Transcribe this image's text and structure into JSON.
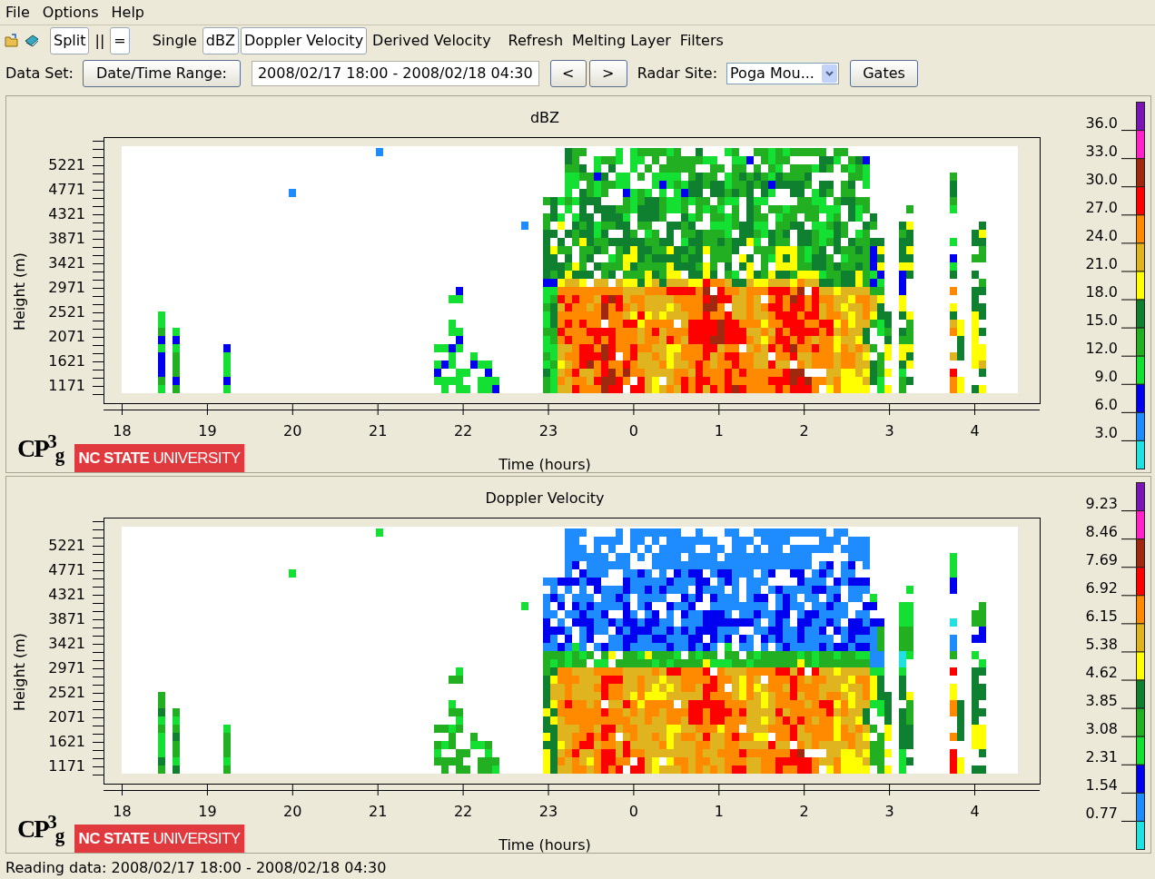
{
  "menu": [
    {
      "label": "File"
    },
    {
      "label": "Options"
    },
    {
      "label": "Help"
    }
  ],
  "toolbar": {
    "items": [
      {
        "label": "Split",
        "selected": true
      },
      {
        "label": "||",
        "selected": false
      },
      {
        "label": "=",
        "selected": true
      },
      {
        "label": "Single",
        "selected": false
      },
      {
        "label": "dBZ",
        "selected": true
      },
      {
        "label": "Doppler Velocity",
        "selected": true
      },
      {
        "label": "Derived Velocity",
        "selected": false
      },
      {
        "label": "Refresh",
        "selected": false
      },
      {
        "label": "Melting Layer",
        "selected": false
      },
      {
        "label": "Filters",
        "selected": false
      }
    ]
  },
  "dataset": {
    "label": "Data Set:",
    "range_button": "Date/Time Range:",
    "range_value": "2008/02/17 18:00 - 2008/02/18 04:30",
    "prev_button": "<",
    "next_button": ">",
    "site_label": "Radar Site:",
    "site_value": "Poga Mou...",
    "gates_button": "Gates"
  },
  "panels": [
    {
      "title": "dBZ",
      "kind": "dbz",
      "ylabel": "Height (m)",
      "xlabel": "Time (hours)",
      "yticks": [
        "5221",
        "4771",
        "4321",
        "3871",
        "3421",
        "2971",
        "2521",
        "2071",
        "1621",
        "1171"
      ],
      "xticks": [
        "18",
        "19",
        "20",
        "21",
        "22",
        "23",
        "0",
        "1",
        "2",
        "3",
        "4"
      ],
      "colorbar": {
        "labels": [
          "36.0",
          "33.0",
          "30.0",
          "27.0",
          "24.0",
          "21.0",
          "18.0",
          "15.0",
          "12.0",
          "9.0",
          "6.0",
          "3.0"
        ],
        "segments": [
          {
            "color": "#7a14b4"
          },
          {
            "color": "#ff22c8"
          },
          {
            "color": "#a0280e"
          },
          {
            "color": "#ff0000"
          },
          {
            "color": "#ff8a00"
          },
          {
            "color": "#e0b41e"
          },
          {
            "color": "#ffff00"
          },
          {
            "color": "#0e8030"
          },
          {
            "color": "#22b022"
          },
          {
            "color": "#14e034"
          },
          {
            "color": "#0000f0"
          },
          {
            "color": "#1e8cff"
          },
          {
            "color": "#20e0e0"
          }
        ]
      },
      "logo": {
        "mark": "CP$^{3}$$_{g}$",
        "banner": "**NC STATE** UNIVERSITY"
      }
    },
    {
      "title": "Doppler Velocity",
      "kind": "velocity",
      "ylabel": "Height (m)",
      "xlabel": "Time (hours)",
      "yticks": [
        "5221",
        "4771",
        "4321",
        "3871",
        "3421",
        "2971",
        "2521",
        "2071",
        "1621",
        "1171"
      ],
      "xticks": [
        "18",
        "19",
        "20",
        "21",
        "22",
        "23",
        "0",
        "1",
        "2",
        "3",
        "4"
      ],
      "colorbar": {
        "labels": [
          "9.23",
          "8.46",
          "7.69",
          "6.92",
          "6.15",
          "5.38",
          "4.62",
          "3.85",
          "3.08",
          "2.31",
          "1.54",
          "0.77"
        ],
        "segments": [
          {
            "color": "#7a14b4"
          },
          {
            "color": "#ff22c8"
          },
          {
            "color": "#a0280e"
          },
          {
            "color": "#ff0000"
          },
          {
            "color": "#ff8a00"
          },
          {
            "color": "#e0b41e"
          },
          {
            "color": "#ffff00"
          },
          {
            "color": "#0e8030"
          },
          {
            "color": "#22b022"
          },
          {
            "color": "#14e034"
          },
          {
            "color": "#0000f0"
          },
          {
            "color": "#1e8cff"
          },
          {
            "color": "#20e0e0"
          }
        ]
      },
      "logo": {
        "mark": "CP$^{3}$$_{g}$",
        "banner": "**NC STATE** UNIVERSITY"
      }
    }
  ],
  "status_bar": "Reading data: 2008/02/17 18:00 - 2008/02/18 04:30"
}
